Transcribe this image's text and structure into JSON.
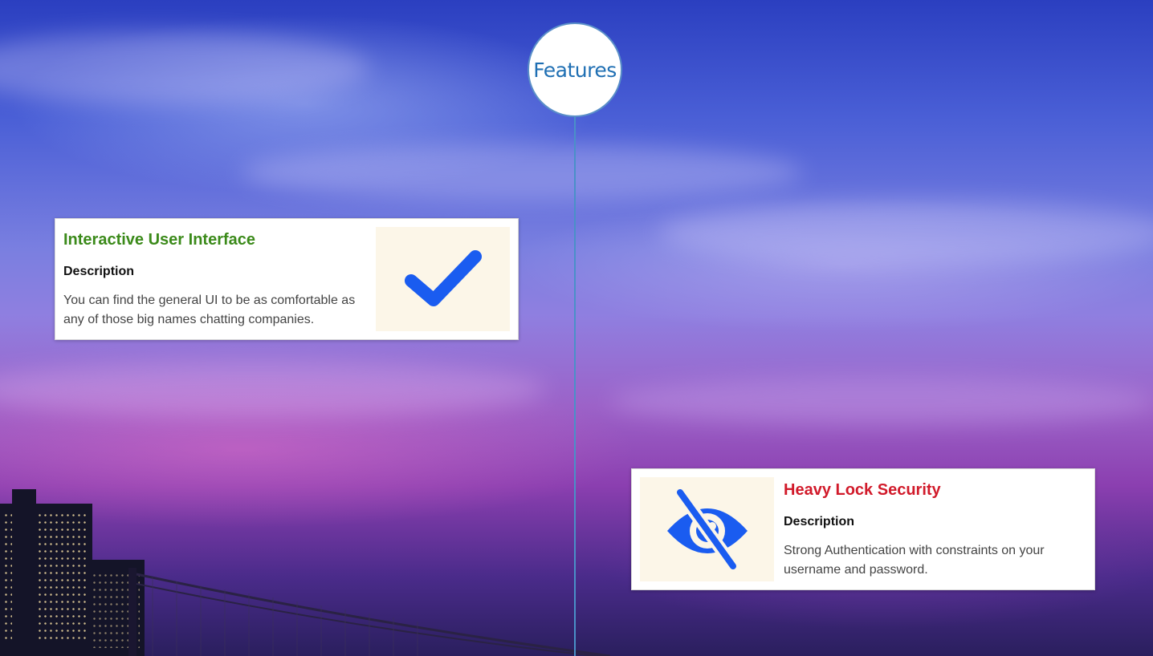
{
  "timeline": {
    "header_label": "Features",
    "line_color": "#4a90c8"
  },
  "features": [
    {
      "title": "Interactive User Interface",
      "title_color": "#3b8a1a",
      "subtitle": "Description",
      "description": "You can find the general UI to be as comfortable as any of those big names chatting companies.",
      "icon": "check-icon",
      "icon_color": "#1a5cf0",
      "side": "left"
    },
    {
      "title": "Heavy Lock Security",
      "title_color": "#d11a2a",
      "subtitle": "Description",
      "description": "Strong Authentication with constraints on your username and password.",
      "icon": "eye-slash-icon",
      "icon_color": "#1a5cf0",
      "side": "right"
    }
  ]
}
